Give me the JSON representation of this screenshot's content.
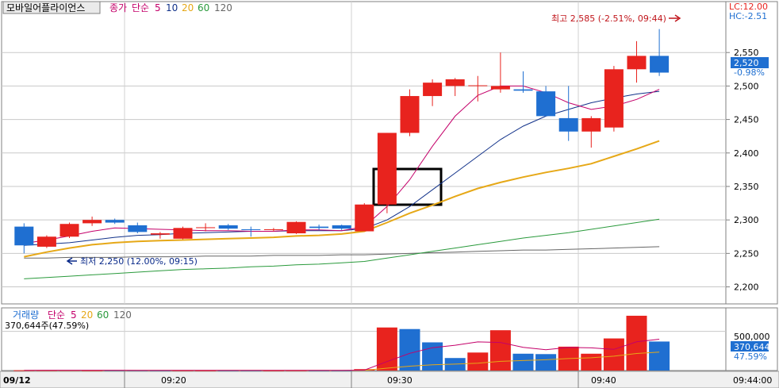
{
  "header": {
    "stock_name": "모바일어플라이언스",
    "price_label": "종가",
    "ma_label": "단순",
    "ma_periods": [
      "5",
      "10",
      "20",
      "60",
      "120"
    ],
    "lc": "LC:12.00",
    "hc": "HC:-2.51"
  },
  "volume_header": {
    "label": "거래량",
    "ma_label": "단순",
    "ma_periods": [
      "5",
      "20",
      "60",
      "120"
    ],
    "current": "370,644주(47.59%)"
  },
  "annotations": {
    "high": "최고 2,585 (-2.51%, 09:44)",
    "low": "최저 2,250 (12.00%, 09:15)"
  },
  "price_axis": {
    "ticks": [
      "2,550",
      "2,500",
      "2,450",
      "2,400",
      "2,350",
      "2,300",
      "2,250",
      "2,200"
    ],
    "current_price": "2,520",
    "current_change": "-0.98%"
  },
  "volume_axis": {
    "tick": "500,000",
    "current_volume": "370,644",
    "current_pct": "47.59%"
  },
  "time_axis": {
    "date": "09/12",
    "labels": [
      "09:20",
      "09:30",
      "09:40"
    ],
    "end_label": "09:44:00"
  },
  "colors": {
    "up": "#e8231e",
    "down": "#1f6fd1",
    "ma5": "#c4006a",
    "ma10": "#12328a",
    "ma20": "#e6a817",
    "ma60": "#2a9a3c",
    "ma120": "#666666"
  },
  "chart_data": {
    "type": "candlestick",
    "interval": "1 minute",
    "y_range": [
      2190,
      2600
    ],
    "candles": [
      {
        "time": "09:15",
        "open": 2290,
        "high": 2295,
        "low": 2250,
        "close": 2262
      },
      {
        "time": "09:16",
        "open": 2260,
        "high": 2277,
        "low": 2258,
        "close": 2275
      },
      {
        "time": "09:17",
        "open": 2275,
        "high": 2296,
        "low": 2273,
        "close": 2294
      },
      {
        "time": "09:18",
        "open": 2295,
        "high": 2305,
        "low": 2291,
        "close": 2300
      },
      {
        "time": "09:19",
        "open": 2300,
        "high": 2302,
        "low": 2294,
        "close": 2296
      },
      {
        "time": "09:20",
        "open": 2292,
        "high": 2296,
        "low": 2280,
        "close": 2282
      },
      {
        "time": "09:21",
        "open": 2278,
        "high": 2282,
        "low": 2272,
        "close": 2280
      },
      {
        "time": "09:22",
        "open": 2272,
        "high": 2290,
        "low": 2271,
        "close": 2288
      },
      {
        "time": "09:23",
        "open": 2288,
        "high": 2295,
        "low": 2283,
        "close": 2289
      },
      {
        "time": "09:24",
        "open": 2292,
        "high": 2294,
        "low": 2285,
        "close": 2287
      },
      {
        "time": "09:25",
        "open": 2286,
        "high": 2290,
        "low": 2275,
        "close": 2285
      },
      {
        "time": "09:26",
        "open": 2285,
        "high": 2288,
        "low": 2283,
        "close": 2286
      },
      {
        "time": "09:27",
        "open": 2280,
        "high": 2298,
        "low": 2279,
        "close": 2297
      },
      {
        "time": "09:28",
        "open": 2290,
        "high": 2293,
        "low": 2285,
        "close": 2288
      },
      {
        "time": "09:29",
        "open": 2292,
        "high": 2293,
        "low": 2285,
        "close": 2287
      },
      {
        "time": "09:30",
        "open": 2283,
        "high": 2325,
        "low": 2283,
        "close": 2323
      },
      {
        "time": "09:31",
        "open": 2323,
        "high": 2430,
        "low": 2310,
        "close": 2430
      },
      {
        "time": "09:32",
        "open": 2430,
        "high": 2495,
        "low": 2425,
        "close": 2485
      },
      {
        "time": "09:33",
        "open": 2485,
        "high": 2510,
        "low": 2470,
        "close": 2505
      },
      {
        "time": "09:34",
        "open": 2500,
        "high": 2512,
        "low": 2485,
        "close": 2510
      },
      {
        "time": "09:35",
        "open": 2501,
        "high": 2515,
        "low": 2477,
        "close": 2501
      },
      {
        "time": "09:36",
        "open": 2495,
        "high": 2550,
        "low": 2490,
        "close": 2500
      },
      {
        "time": "09:37",
        "open": 2495,
        "high": 2522,
        "low": 2490,
        "close": 2493
      },
      {
        "time": "09:38",
        "open": 2492,
        "high": 2500,
        "low": 2455,
        "close": 2455
      },
      {
        "time": "09:39",
        "open": 2452,
        "high": 2500,
        "low": 2418,
        "close": 2432
      },
      {
        "time": "09:40",
        "open": 2432,
        "high": 2455,
        "low": 2408,
        "close": 2452
      },
      {
        "time": "09:41",
        "open": 2438,
        "high": 2530,
        "low": 2432,
        "close": 2525
      },
      {
        "time": "09:42",
        "open": 2525,
        "high": 2567,
        "low": 2505,
        "close": 2545
      },
      {
        "time": "09:43",
        "open": 2545,
        "high": 2585,
        "low": 2515,
        "close": 2520
      }
    ],
    "ma5": [
      2265,
      2270,
      2276,
      2283,
      2288,
      2287,
      2286,
      2285,
      2284,
      2284,
      2283,
      2283,
      2285,
      2285,
      2284,
      2290,
      2320,
      2360,
      2410,
      2455,
      2486,
      2500,
      2500,
      2490,
      2475,
      2465,
      2470,
      2480,
      2495
    ],
    "ma10": [
      2262,
      2264,
      2266,
      2270,
      2274,
      2277,
      2278,
      2280,
      2281,
      2282,
      2283,
      2283,
      2284,
      2284,
      2284,
      2287,
      2300,
      2320,
      2345,
      2370,
      2395,
      2420,
      2440,
      2455,
      2465,
      2475,
      2482,
      2488,
      2492
    ],
    "ma20": [
      2245,
      2252,
      2258,
      2263,
      2266,
      2268,
      2269,
      2270,
      2271,
      2272,
      2273,
      2274,
      2276,
      2277,
      2279,
      2283,
      2296,
      2310,
      2322,
      2335,
      2347,
      2356,
      2364,
      2371,
      2377,
      2384,
      2395,
      2406,
      2418
    ],
    "ma60": [
      2212,
      2214,
      2216,
      2218,
      2220,
      2222,
      2224,
      2226,
      2227,
      2228,
      2230,
      2231,
      2233,
      2234,
      2236,
      2238,
      2243,
      2248,
      2253,
      2258,
      2263,
      2268,
      2273,
      2277,
      2281,
      2286,
      2291,
      2296,
      2301
    ],
    "ma120": [
      2243,
      2243,
      2244,
      2244,
      2244,
      2245,
      2245,
      2245,
      2246,
      2246,
      2246,
      2247,
      2247,
      2247,
      2248,
      2248,
      2249,
      2250,
      2251,
      2252,
      2253,
      2254,
      2255,
      2255,
      2256,
      2257,
      2258,
      2259,
      2260
    ],
    "volume": [
      4000,
      4000,
      5000,
      3000,
      3000,
      3000,
      2000,
      3000,
      2000,
      2000,
      2000,
      2000,
      3000,
      2000,
      2000,
      18000,
      550000,
      530000,
      360000,
      160000,
      230000,
      515000,
      215000,
      210000,
      305000,
      215000,
      410000,
      700000,
      370644
    ],
    "volume_up": [
      true,
      true,
      true,
      true,
      false,
      false,
      false,
      true,
      true,
      false,
      false,
      true,
      true,
      false,
      false,
      true,
      true,
      false,
      false,
      false,
      true,
      true,
      false,
      false,
      true,
      true,
      true,
      true,
      false
    ],
    "volume_ma5": [
      3500,
      3600,
      3800,
      3700,
      3600,
      3400,
      3200,
      3000,
      2800,
      2400,
      2200,
      2200,
      2200,
      2200,
      2200,
      5000,
      115000,
      220000,
      292000,
      323000,
      366000,
      359000,
      296000,
      266000,
      295000,
      290000,
      271000,
      367000,
      400000
    ],
    "volume_ma20": [
      3000,
      3000,
      3100,
      3100,
      3100,
      3100,
      3000,
      3000,
      3000,
      3000,
      2900,
      2900,
      2900,
      2800,
      2800,
      3500,
      30000,
      56000,
      74000,
      82000,
      93000,
      118000,
      128000,
      138000,
      153000,
      163000,
      183000,
      218000,
      236000
    ]
  }
}
